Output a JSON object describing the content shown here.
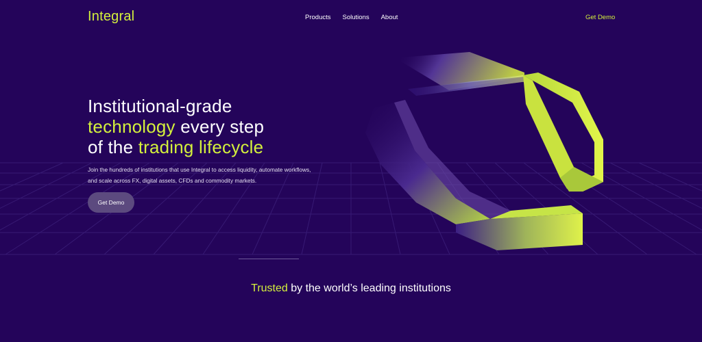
{
  "nav": {
    "logo": "Integral",
    "links": [
      "Products",
      "Solutions",
      "About"
    ],
    "cta": "Get Demo"
  },
  "hero": {
    "line1": "Institutional-grade",
    "line2_accent": "technology",
    "line2_rest": " every step",
    "line3_pre": "of the ",
    "line3_accent": "trading lifecycle",
    "subtitle": "Join the hundreds of institutions that use Integral to access liquidity, automate workflows, and scale across FX, digital assets, CFDs and commodity markets.",
    "button": "Get Demo"
  },
  "trusted": {
    "accent": "Trusted",
    "rest": " by the world’s leading institutions"
  },
  "colors": {
    "background": "#24045a",
    "accent": "#d4f03c",
    "button_bg": "#5c4a7f"
  }
}
